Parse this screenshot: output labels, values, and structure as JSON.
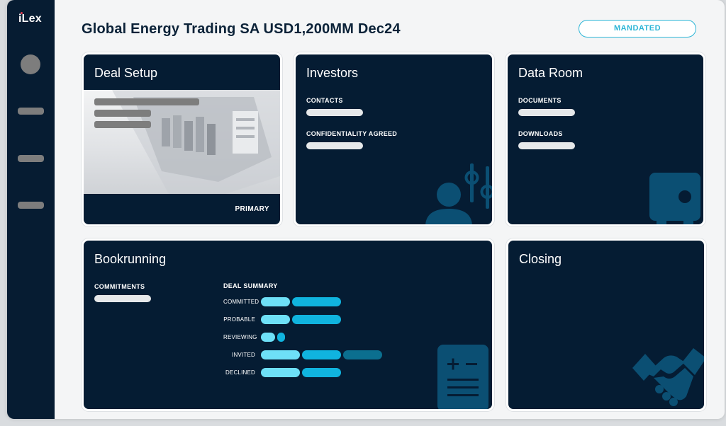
{
  "app": {
    "logo": "iLex"
  },
  "header": {
    "title": "Global Energy Trading SA USD1,200MM Dec24",
    "status": "MANDATED"
  },
  "colors": {
    "navy": "#051c33",
    "accent": "#2cb5d6",
    "light_cyan": "#6ee0f7",
    "cyan": "#10b4df",
    "teal": "#0b6f8f",
    "icon_blue": "#0b4f73"
  },
  "cards": {
    "deal_setup": {
      "title": "Deal Setup",
      "tag": "PRIMARY"
    },
    "investors": {
      "title": "Investors",
      "fields": [
        "CONTACTS",
        "CONFIDENTIALITY AGREED"
      ],
      "icon": "investor-settings-icon"
    },
    "data_room": {
      "title": "Data Room",
      "fields": [
        "DOCUMENTS",
        "DOWNLOADS"
      ],
      "icon": "safe-icon"
    },
    "bookrunning": {
      "title": "Bookrunning",
      "commitments_label": "COMMITMENTS",
      "summary_label": "DEAL SUMMARY",
      "rows": [
        "COMMITTED",
        "PROBABLE",
        "REVIEWING",
        "INVITED",
        "DECLINED"
      ],
      "icon": "calculator-document-icon"
    },
    "closing": {
      "title": "Closing",
      "icon": "handshake-icon"
    }
  }
}
